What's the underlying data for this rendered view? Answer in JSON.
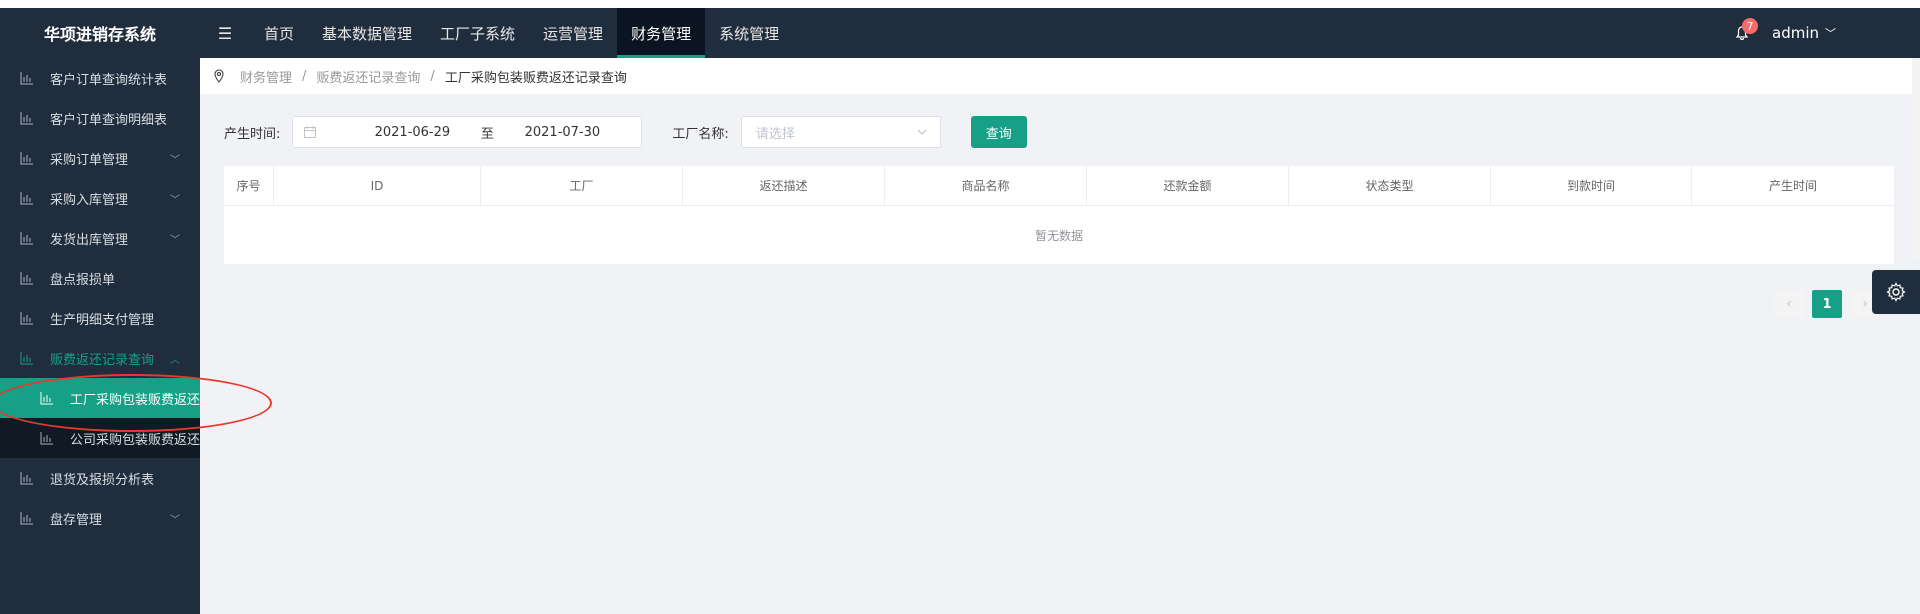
{
  "app": {
    "title": "华项进销存系统"
  },
  "topnav": {
    "toggle_glyph": "☰",
    "items": [
      {
        "label": "首页"
      },
      {
        "label": "基本数据管理"
      },
      {
        "label": "工厂子系统"
      },
      {
        "label": "运营管理"
      },
      {
        "label": "财务管理",
        "active": true
      },
      {
        "label": "系统管理"
      }
    ],
    "notification_count": "7",
    "user": "admin"
  },
  "sidebar": {
    "items": [
      {
        "label": "客户订单查询统计表"
      },
      {
        "label": "客户订单查询明细表"
      },
      {
        "label": "采购订单管理"
      },
      {
        "label": "采购入库管理"
      },
      {
        "label": "发货出库管理"
      },
      {
        "label": "盘点报损单"
      },
      {
        "label": "生产明细支付管理"
      },
      {
        "label": "贩费返还记录查询"
      },
      {
        "label": "工厂采购包装贩费返还"
      },
      {
        "label": "公司采购包装贩费返还"
      },
      {
        "label": "退货及报损分析表"
      },
      {
        "label": "盘存管理"
      }
    ]
  },
  "breadcrumb": {
    "level1": "财务管理",
    "level2": "贩费返还记录查询",
    "current": "工厂采购包装贩费返还记录查询",
    "separator": "/"
  },
  "filters": {
    "date_label": "产生时间:",
    "date_start": "2021-06-29",
    "date_to": "至",
    "date_end": "2021-07-30",
    "factory_label": "工厂名称:",
    "factory_placeholder": "请选择",
    "query_button": "查询"
  },
  "table": {
    "columns": [
      "序号",
      "ID",
      "工厂",
      "返还描述",
      "商品名称",
      "还款金额",
      "状态类型",
      "到款时间",
      "产生时间"
    ],
    "empty_text": "暂无数据"
  },
  "pagination": {
    "current_page": "1",
    "prev": "‹",
    "next": "›"
  },
  "colors": {
    "accent": "#16a085",
    "sidebar_bg": "#1f2d3d",
    "annotation": "#e8382c"
  },
  "icons": {
    "sidebar": "chart-icon",
    "breadcrumb": "location-pin-icon",
    "calendar": "calendar-icon",
    "settings": "gear-icon",
    "bell": "bell-icon"
  }
}
